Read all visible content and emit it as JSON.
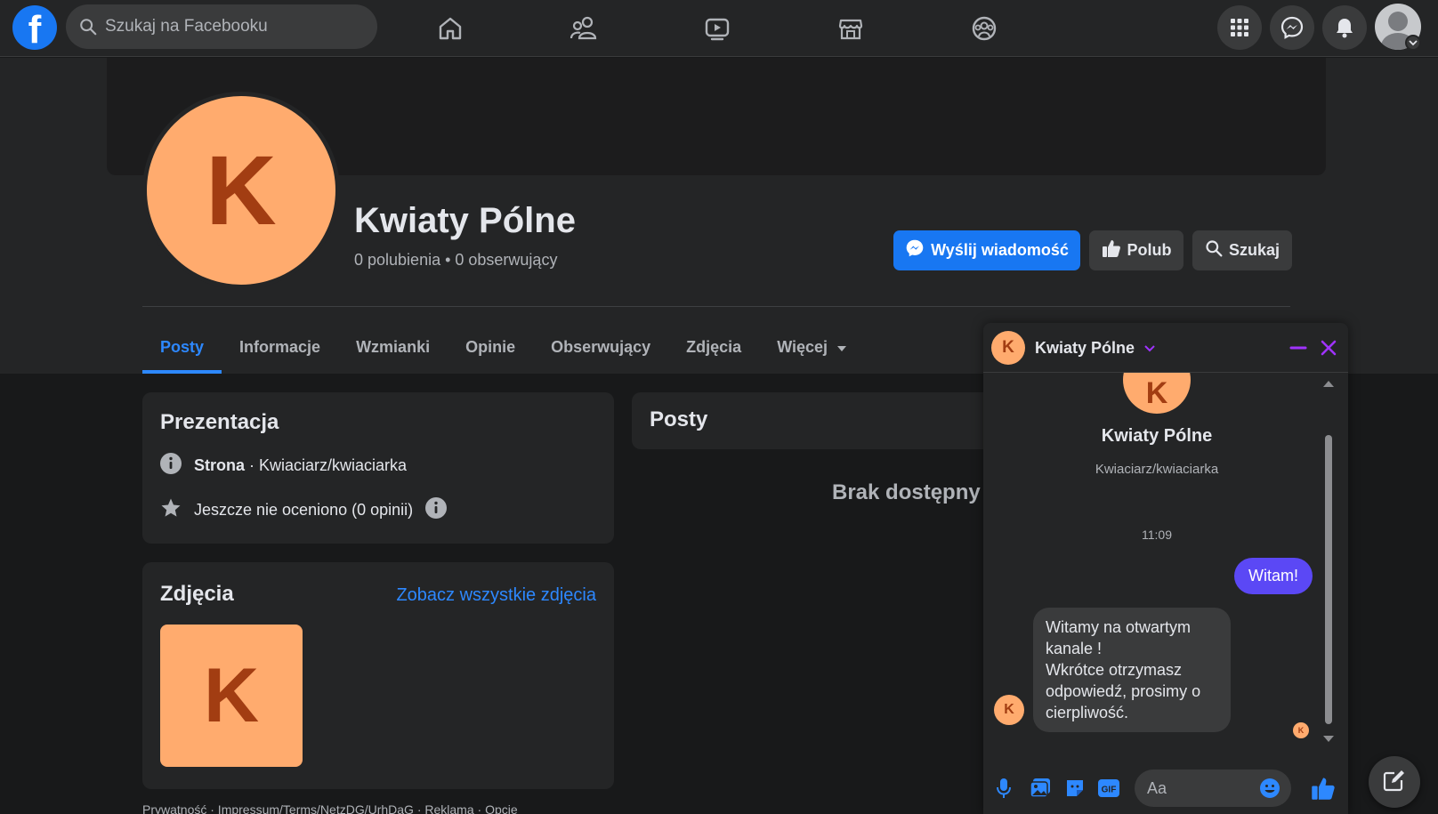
{
  "topbar": {
    "logo_letter": "f",
    "search_placeholder": "Szukaj na Facebooku",
    "nav_icons": [
      "home-icon",
      "friends-icon",
      "watch-icon",
      "marketplace-icon",
      "groups-icon"
    ],
    "right_icons": [
      "menu-grid-icon",
      "messenger-icon",
      "notifications-icon"
    ]
  },
  "profile": {
    "avatar_letter": "K",
    "name": "Kwiaty Pólne",
    "stats": "0 polubienia • 0 obserwujący",
    "buttons": {
      "message": "Wyślij wiadomość",
      "like": "Polub",
      "search": "Szukaj"
    },
    "tabs": [
      "Posty",
      "Informacje",
      "Wzmianki",
      "Opinie",
      "Obserwujący",
      "Zdjęcia",
      "Więcej"
    ],
    "active_tab": "Posty"
  },
  "intro": {
    "title": "Prezentacja",
    "category_bold": "Strona",
    "category_rest": " · Kwiaciarz/kwiaciarka",
    "rating": "Jeszcze nie oceniono (0 opinii)"
  },
  "photos": {
    "title": "Zdjęcia",
    "see_all": "Zobacz wszystkie zdjęcia",
    "photo_letter": "K"
  },
  "posts": {
    "title": "Posty",
    "empty": "Brak dostępny"
  },
  "footer": {
    "text": "Prywatność · Impressum/Terms/NetzDG/UrhDaG · Reklama · Opcje"
  },
  "chat": {
    "header_name": "Kwiaty Pólne",
    "avatar_letter": "K",
    "page_name": "Kwiaty Pólne",
    "category": "Kwiaciarz/kwiaciarka",
    "time": "11:09",
    "outgoing": "Witam!",
    "incoming_lines": [
      "Witamy na otwartym",
      "kanale !",
      "Wkrótce otrzymasz",
      "odpowiedź, prosimy o",
      "cierpliwość."
    ],
    "input_placeholder": "Aa"
  },
  "colors": {
    "accent": "#1877f2",
    "link": "#2d88ff",
    "bubble_out": "#5b48f5",
    "avatar_bg": "#ffab6e",
    "avatar_letter": "#a23d12",
    "chat_controls": "#a033ff"
  }
}
